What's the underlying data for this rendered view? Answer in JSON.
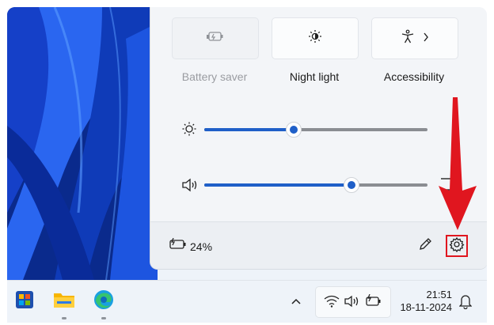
{
  "quick_settings": {
    "tiles": [
      {
        "label": "Battery saver",
        "icon": "battery-saver-icon",
        "enabled": false
      },
      {
        "label": "Night light",
        "icon": "night-light-icon",
        "enabled": true
      },
      {
        "label": "Accessibility",
        "icon": "accessibility-icon",
        "enabled": true,
        "has_chevron": true
      }
    ],
    "brightness": {
      "icon": "brightness-icon",
      "level": 0.4
    },
    "volume": {
      "icon": "volume-icon",
      "level": 0.66
    }
  },
  "footer": {
    "battery_icon": "battery-charging-icon",
    "battery_text": "24%",
    "edit_icon": "pencil-icon",
    "settings_icon": "gear-icon"
  },
  "annotation": {
    "arrow_color": "#e0161f"
  },
  "taskbar": {
    "apps": [
      "start-icon",
      "file-explorer-icon",
      "edge-icon"
    ],
    "tray_icons": [
      "wifi-icon",
      "volume-icon",
      "battery-icon"
    ],
    "time": "21:51",
    "date": "18-11-2024"
  },
  "colors": {
    "accent": "#1f5fc8"
  }
}
